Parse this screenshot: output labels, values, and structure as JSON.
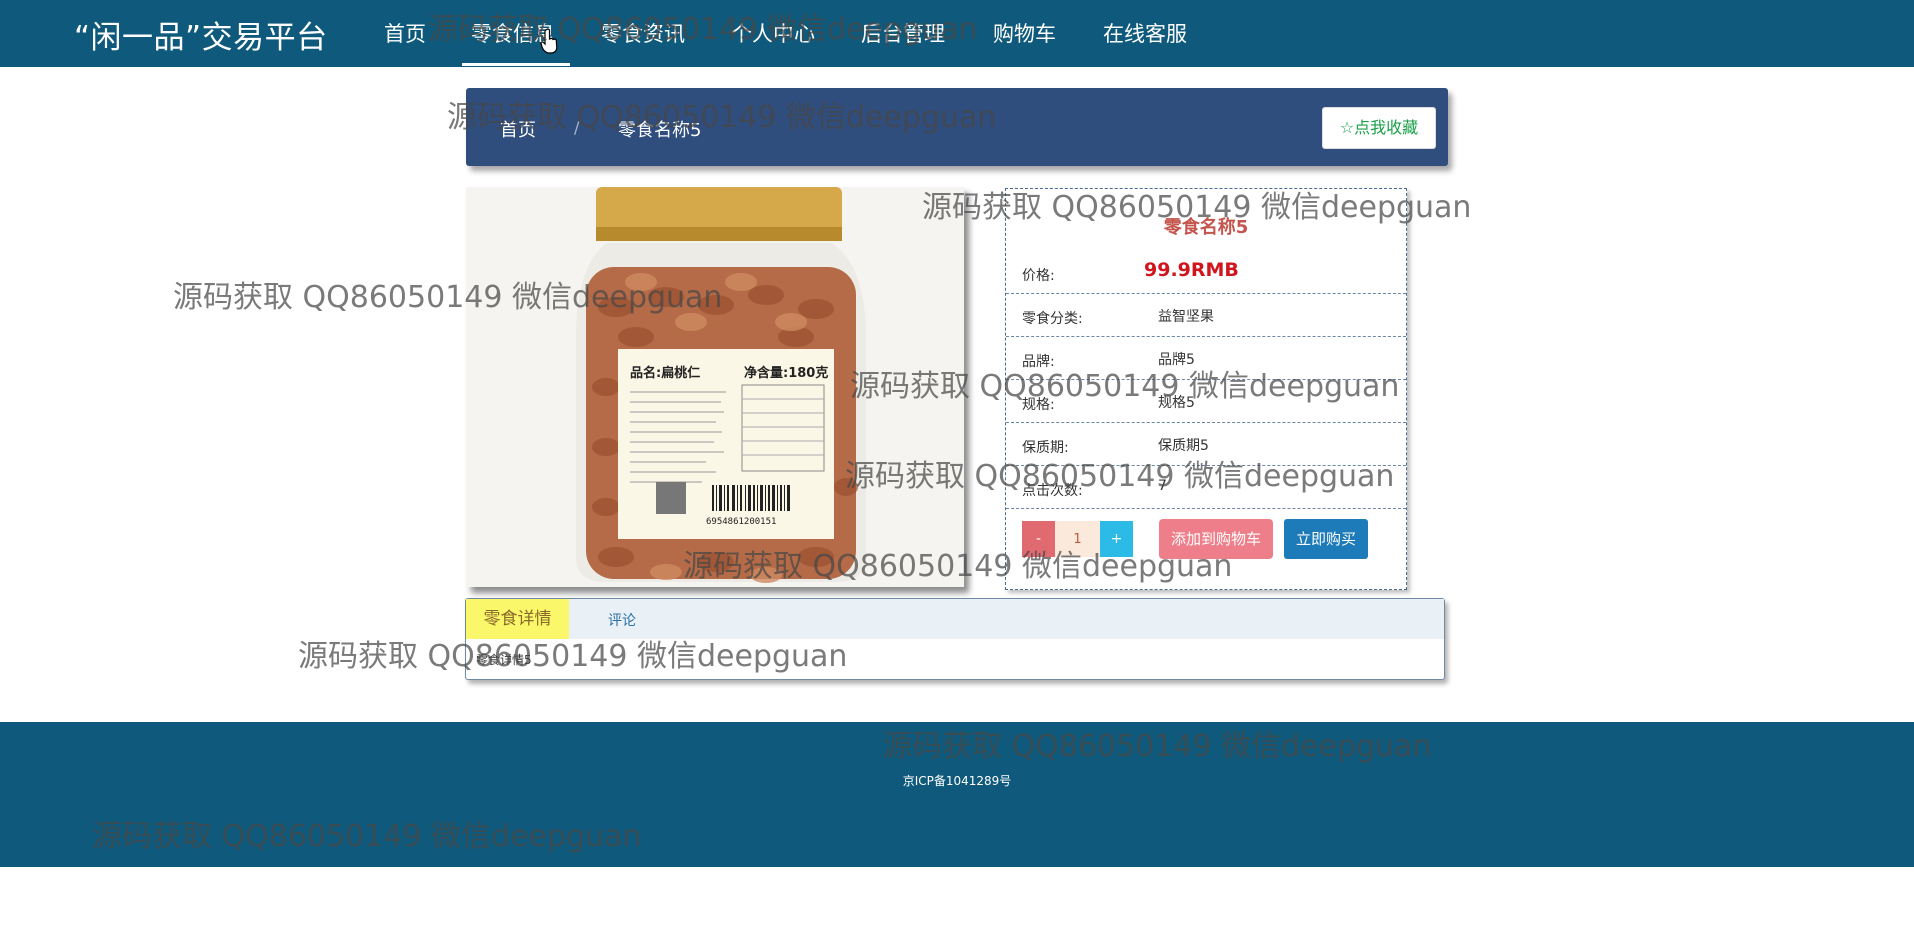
{
  "header": {
    "brand": "“闲一品”交易平台",
    "nav": [
      "首页",
      "零食信息",
      "零食资讯",
      "个人中心",
      "后台管理",
      "购物车",
      "在线客服"
    ],
    "active_index": 1
  },
  "breadcrumb": {
    "home": "首页",
    "separator": "/",
    "current": "零食名称5",
    "favorite_button": "☆点我收藏"
  },
  "product": {
    "image_alt": "扁桃仁罐装零食图片",
    "image_label": {
      "name": "品名:扁桃仁",
      "net": "净含量:180克",
      "barcode_number": "6954861200151"
    },
    "title": "零食名称5",
    "fields": [
      {
        "label": "价格:",
        "value": "99.9RMB"
      },
      {
        "label": "零食分类:",
        "value": "益智坚果"
      },
      {
        "label": "品牌:",
        "value": "品牌5"
      },
      {
        "label": "规格:",
        "value": "规格5"
      },
      {
        "label": "保质期:",
        "value": "保质期5"
      },
      {
        "label": "点击次数:",
        "value": "7"
      }
    ],
    "quantity": "1",
    "minus": "-",
    "plus": "+",
    "add_to_cart": "添加到购物车",
    "buy_now": "立即购买"
  },
  "tabs": {
    "detail": "零食详情",
    "comments": "评论",
    "content": "零食详情5"
  },
  "footer": {
    "icp": "京ICP备1041289号"
  },
  "watermark": "源码获取 QQ86050149 微信deepguan",
  "colors": {
    "nav_bg": "#0f5a7c",
    "breadcrumb_bg": "#2f4e7e",
    "price": "#d0151c",
    "title": "#c4554d",
    "cart_button": "#ee7f8a",
    "buy_button": "#1c7bb8",
    "active_tab": "#fbf76a"
  }
}
